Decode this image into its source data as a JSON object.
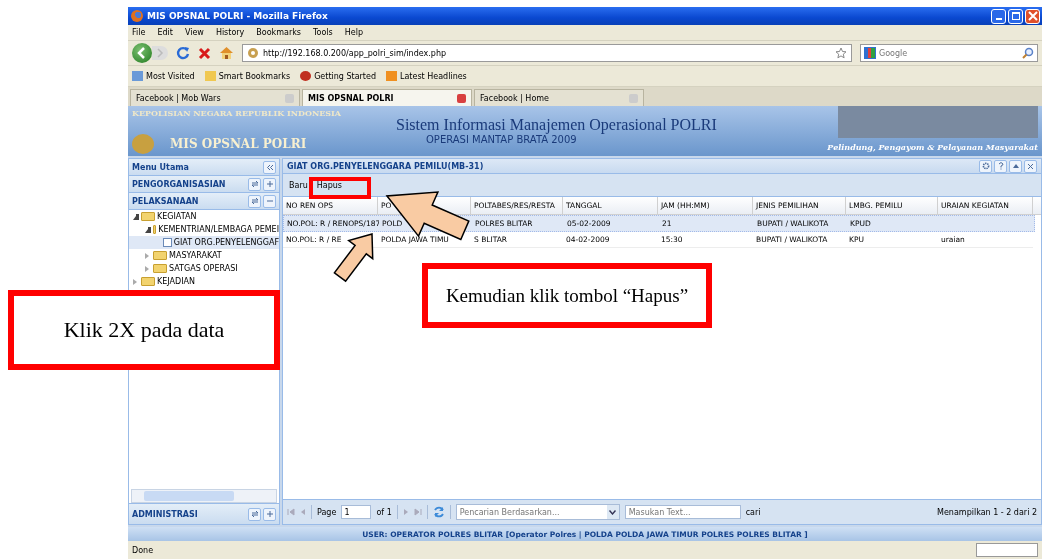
{
  "window": {
    "title": "MIS OPSNAL POLRI - Mozilla Firefox"
  },
  "menu": [
    "File",
    "Edit",
    "View",
    "History",
    "Bookmarks",
    "Tools",
    "Help"
  ],
  "address_bar": {
    "value": "http://192.168.0.200/app_polri_sim/index.php"
  },
  "search": {
    "placeholder": "Google"
  },
  "bookmarks": [
    "Most Visited",
    "Smart Bookmarks",
    "Getting Started",
    "Latest Headlines"
  ],
  "tabs": [
    {
      "label": "Facebook | Mob Wars",
      "selected": false
    },
    {
      "label": "MIS OPSNAL POLRI",
      "selected": true
    },
    {
      "label": "Facebook | Home",
      "selected": false
    }
  ],
  "banner": {
    "agency": "KEPOLISIAN NEGARA REPUBLIK INDONESIA",
    "app_name": "MIS OPSNAL POLRI",
    "title": "Sistem Informasi Manajemen Operasional POLRI",
    "subtitle": "OPERASI MANTAP BRATA 2009",
    "motto": "Pelindung, Pengayom & Pelayanan Masyarakat"
  },
  "sidebar": {
    "title": "Menu Utama",
    "sections": [
      {
        "label": "PENGORGANISASIAN",
        "expanded": false
      },
      {
        "label": "PELAKSANAAN",
        "expanded": true
      }
    ],
    "tree": [
      {
        "label": "KEGIATAN",
        "expanded": true,
        "selected": false,
        "children": [
          {
            "label": "KEMENTRIAN/LEMBAGA PEMEI",
            "expanded": true,
            "selected": false,
            "children": [
              {
                "label": "GIAT ORG.PENYELENGGAF",
                "selected": true
              }
            ]
          },
          {
            "label": "MASYARAKAT",
            "expanded": false,
            "selected": false
          },
          {
            "label": "SATGAS OPERASI",
            "expanded": false,
            "selected": false
          }
        ]
      },
      {
        "label": "KEJADIAN",
        "expanded": false,
        "selected": false
      }
    ],
    "footer_section": {
      "label": "ADMINISTRASI",
      "expanded": false
    }
  },
  "panel": {
    "title": "GIAT ORG.PENYELENGGARA PEMILU(MB-31)",
    "toolbar": [
      "Baru",
      "Hapus"
    ],
    "columns": [
      "NO REN OPS",
      "PO",
      "POLTABES/RES/RESTA",
      "TANGGAL",
      "JAM (HH:MM)",
      "JENIS PEMILIHAN",
      "LMBG. PEMILU",
      "URAIAN KEGIATAN"
    ],
    "rows": [
      {
        "selected": true,
        "cells": [
          "NO.POL: R / RENOPS/187",
          "POLD",
          "POLRES BLITAR",
          "05-02-2009",
          "21",
          "BUPATI / WALIKOTA",
          "KPUD",
          ""
        ]
      },
      {
        "selected": false,
        "cells": [
          "NO.POL: R / RE",
          "POLDA JAWA TIMU",
          "S BLITAR",
          "04-02-2009",
          "15:30",
          "BUPATI / WALIKOTA",
          "KPU",
          "uraian"
        ]
      }
    ],
    "paging": {
      "page_label": "Page",
      "page": "1",
      "of": "of 1",
      "filter_placeholder": "Pencarian Berdasarkan...",
      "text_placeholder": "Masukan Text...",
      "search_label": "cari",
      "summary": "Menampilkan 1 - 2 dari 2"
    }
  },
  "app_status": "USER: OPERATOR POLRES BLITAR [Operator Polres | POLDA POLDA JAWA TIMUR POLRES POLRES BLITAR ]",
  "status_bar": "Done",
  "callouts": [
    "Klik 2X pada data",
    "Kemudian klik tombol “Hapus”"
  ]
}
